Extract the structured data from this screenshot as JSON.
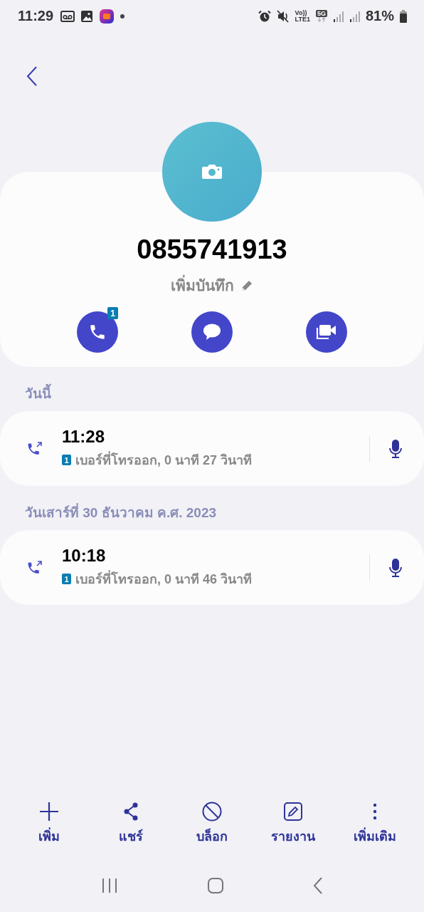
{
  "status_bar": {
    "time": "11:29",
    "volte": "Vo))",
    "lte": "LTE1",
    "network": "5G",
    "battery": "81%"
  },
  "contact": {
    "number": "0855741913",
    "note": "เพิ่มบันทึก",
    "actions": [
      {
        "kind": "call",
        "badge": "1"
      },
      {
        "kind": "message"
      },
      {
        "kind": "video"
      }
    ]
  },
  "call_log": [
    {
      "header": "วันนี้",
      "entries": [
        {
          "time": "11:28",
          "sim": "1",
          "detail": "เบอร์ที่โทรออก, 0 นาที 27 วินาที"
        }
      ]
    },
    {
      "header": "วันเสาร์ที่ 30 ธันวาคม ค.ศ. 2023",
      "entries": [
        {
          "time": "10:18",
          "sim": "1",
          "detail": "เบอร์ที่โทรออก, 0 นาที 46 วินาที"
        }
      ]
    }
  ],
  "bottom_bar": [
    {
      "kind": "add",
      "label": "เพิ่ม"
    },
    {
      "kind": "share",
      "label": "แชร์"
    },
    {
      "kind": "block",
      "label": "บล็อก"
    },
    {
      "kind": "report",
      "label": "รายงาน"
    },
    {
      "kind": "more",
      "label": "เพิ่มเติม"
    }
  ]
}
